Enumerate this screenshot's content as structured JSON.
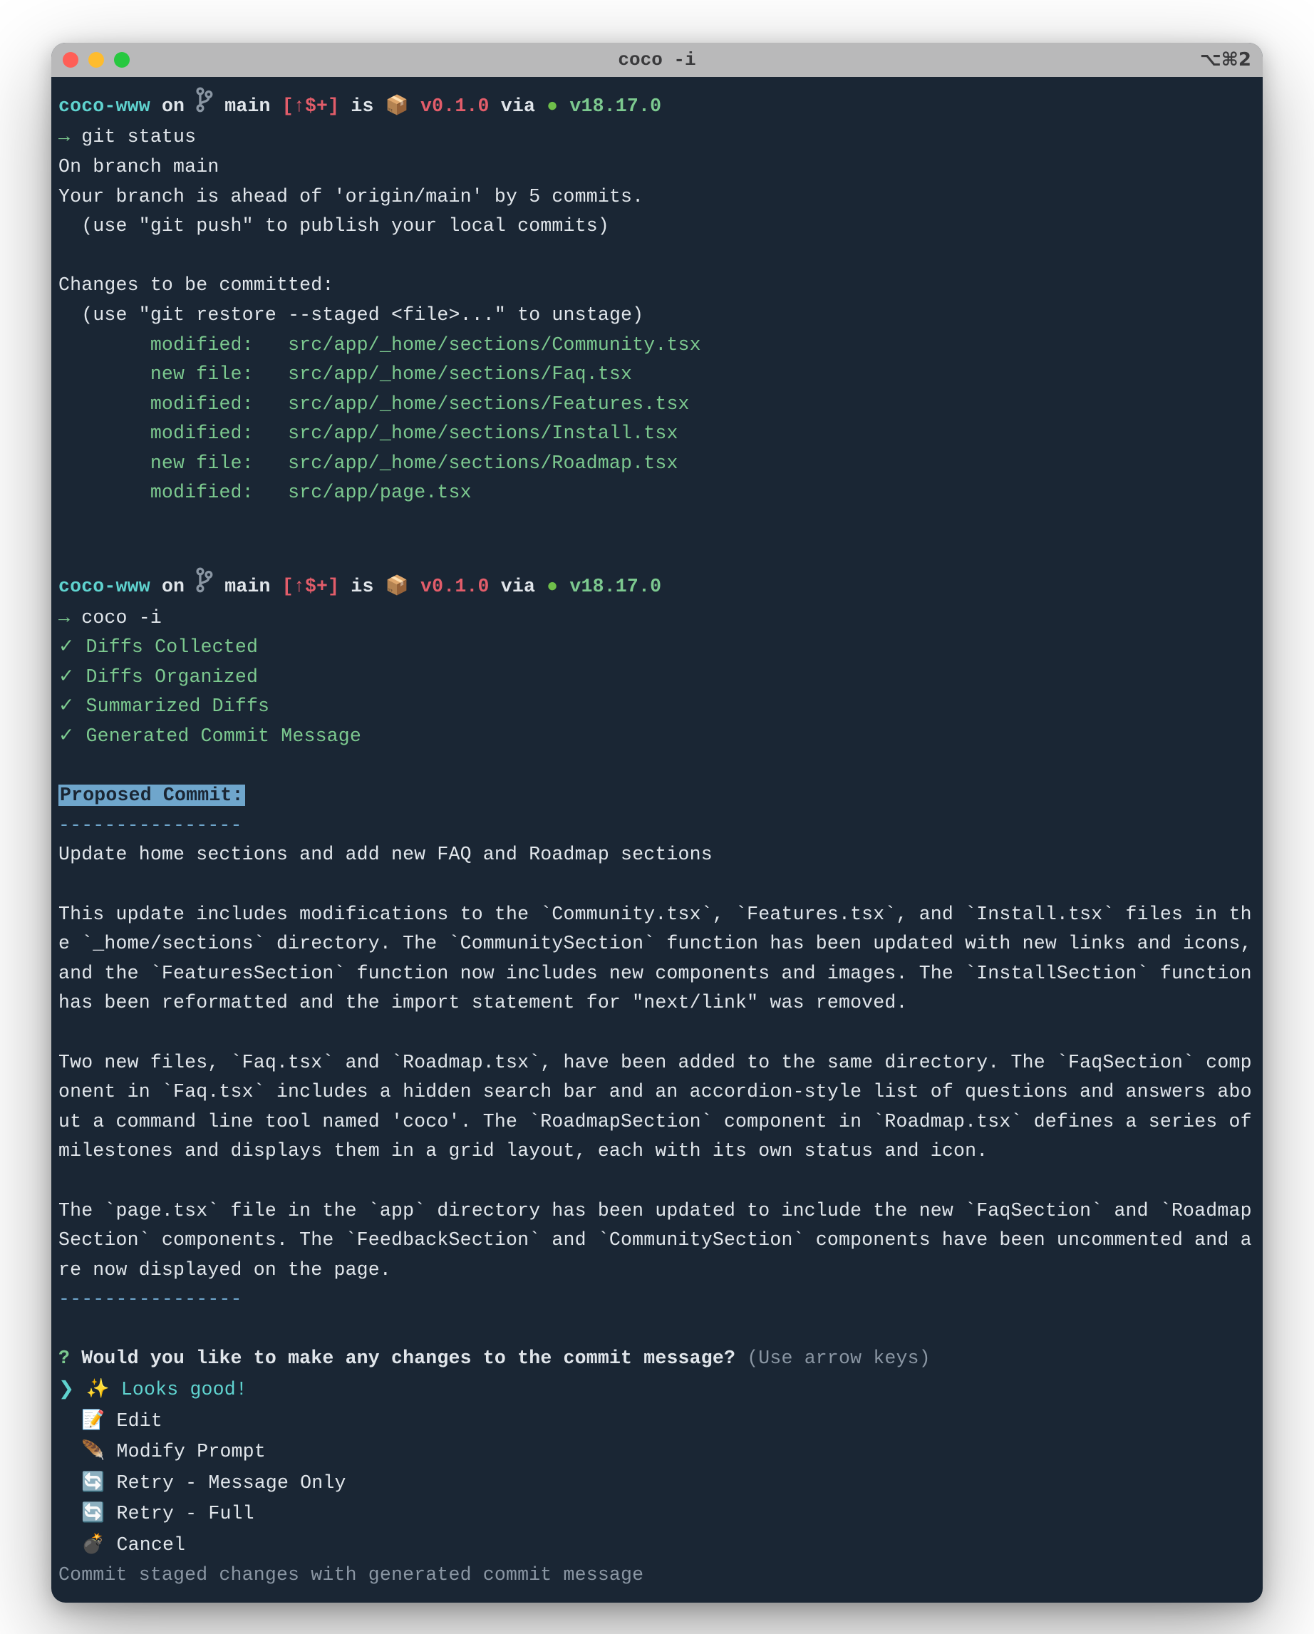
{
  "window": {
    "title": "coco -i",
    "tab_hint": "⌥⌘2"
  },
  "prompt": {
    "dir": "coco-www",
    "on": "on",
    "branch": "main",
    "status_sym": "[↑$+]",
    "is": "is",
    "box_emoji": "📦",
    "pkg_version": "v0.1.0",
    "via": "via",
    "node_dot": "●",
    "node_version": "v18.17.0",
    "arrow": "→"
  },
  "cmd1": "git status",
  "git": {
    "l1": "On branch main",
    "l2": "Your branch is ahead of 'origin/main' by 5 commits.",
    "l3": "  (use \"git push\" to publish your local commits)",
    "l4": "Changes to be committed:",
    "l5": "  (use \"git restore --staged <file>...\" to unstage)",
    "files": [
      {
        "status": "modified:   ",
        "path": "src/app/_home/sections/Community.tsx"
      },
      {
        "status": "new file:   ",
        "path": "src/app/_home/sections/Faq.tsx"
      },
      {
        "status": "modified:   ",
        "path": "src/app/_home/sections/Features.tsx"
      },
      {
        "status": "modified:   ",
        "path": "src/app/_home/sections/Install.tsx"
      },
      {
        "status": "new file:   ",
        "path": "src/app/_home/sections/Roadmap.tsx"
      },
      {
        "status": "modified:   ",
        "path": "src/app/page.tsx"
      }
    ]
  },
  "cmd2": "coco -i",
  "steps": [
    "Diffs Collected",
    "Diffs Organized",
    "Summarized Diffs",
    "Generated Commit Message"
  ],
  "check": "✓",
  "proposed_label": "Proposed Commit:",
  "dash": "----------------",
  "commit_title": "Update home sections and add new FAQ and Roadmap sections",
  "body1": "This update includes modifications to the `Community.tsx`, `Features.tsx`, and `Install.tsx` files in the `_home/sections` directory. The `CommunitySection` function has been updated with new links and icons, and the `FeaturesSection` function now includes new components and images. The `InstallSection` function has been reformatted and the import statement for \"next/link\" was removed.",
  "body2": "Two new files, `Faq.tsx` and `Roadmap.tsx`, have been added to the same directory. The `FaqSection` component in `Faq.tsx` includes a hidden search bar and an accordion-style list of questions and answers about a command line tool named 'coco'. The `RoadmapSection` component in `Roadmap.tsx` defines a series of milestones and displays them in a grid layout, each with its own status and icon.",
  "body3": "The `page.tsx` file in the `app` directory has been updated to include the new `FaqSection` and `RoadmapSection` components. The `FeedbackSection` and `CommunitySection` components have been uncommented and are now displayed on the page.",
  "question_mark": "?",
  "question": "Would you like to make any changes to the commit message?",
  "hint": "(Use arrow keys)",
  "menu_ptr": "❯",
  "menu": [
    {
      "emoji": "✨",
      "label": "Looks good!"
    },
    {
      "emoji": "📝",
      "label": "Edit"
    },
    {
      "emoji": "🪶",
      "label": "Modify Prompt"
    },
    {
      "emoji": "🔄",
      "label": "Retry - Message Only"
    },
    {
      "emoji": "🔄",
      "label": "Retry - Full"
    },
    {
      "emoji": "💣",
      "label": "Cancel"
    }
  ],
  "footer": "Commit staged changes with generated commit message"
}
